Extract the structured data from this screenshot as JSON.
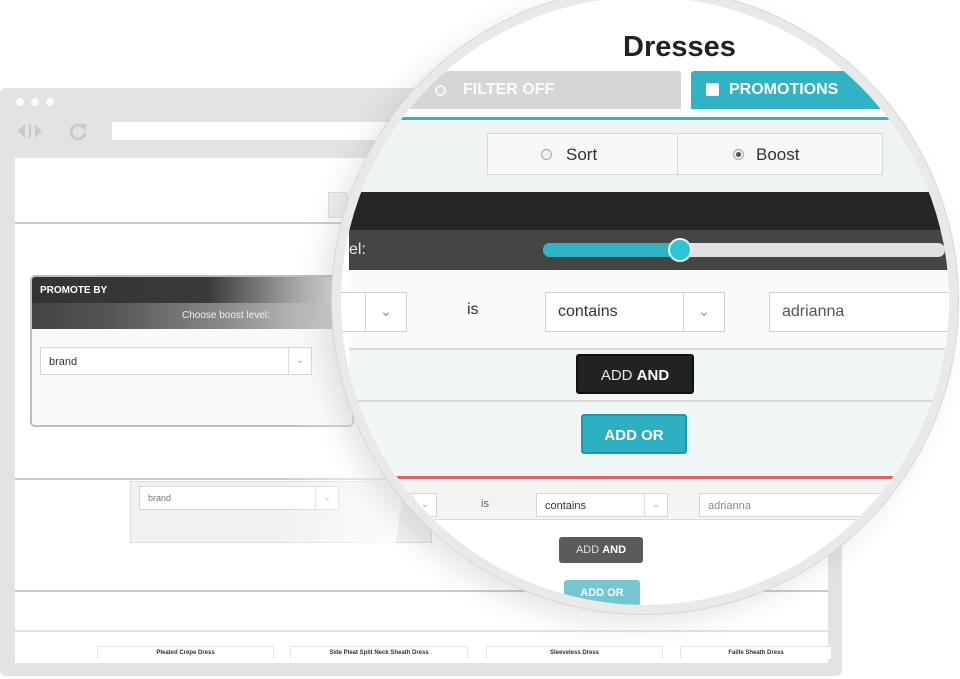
{
  "page_title": "Dresses",
  "tabs": {
    "filter_off": "FILTER OFF",
    "promotions": "PROMOTIONS"
  },
  "sort_boost": {
    "sort_label": "Sort",
    "boost_label": "Boost",
    "selected": "Boost"
  },
  "boost_level": {
    "label_fragment": "el:",
    "value": 0.34
  },
  "rule": {
    "field_value": "brand",
    "operator_label": "is",
    "condition_value": "contains",
    "text_value": "adrianna"
  },
  "buttons": {
    "add_and_light": "ADD ",
    "add_and_bold": "AND",
    "add_or": "ADD OR"
  },
  "promote_panel": {
    "title": "PROMOTE BY",
    "boost_label": "Choose boost level:",
    "field_value": "brand"
  },
  "products": [
    "Pleated Crepe Dress",
    "Side Pleat Split Neck Sheath Dress",
    "Sleeveless Dress",
    "Faille Sheath Dress"
  ],
  "colors": {
    "teal": "#2fb3c5",
    "dark_bar": "#2a2a2a",
    "tab_grey": "#d4d4d4",
    "red_rule": "#e06262"
  },
  "icons": {
    "back_forward": "back-forward-arrows-icon",
    "reload": "reload-icon",
    "chevron": "chevron-down-icon",
    "checkbox": "checked-checkbox-icon"
  }
}
